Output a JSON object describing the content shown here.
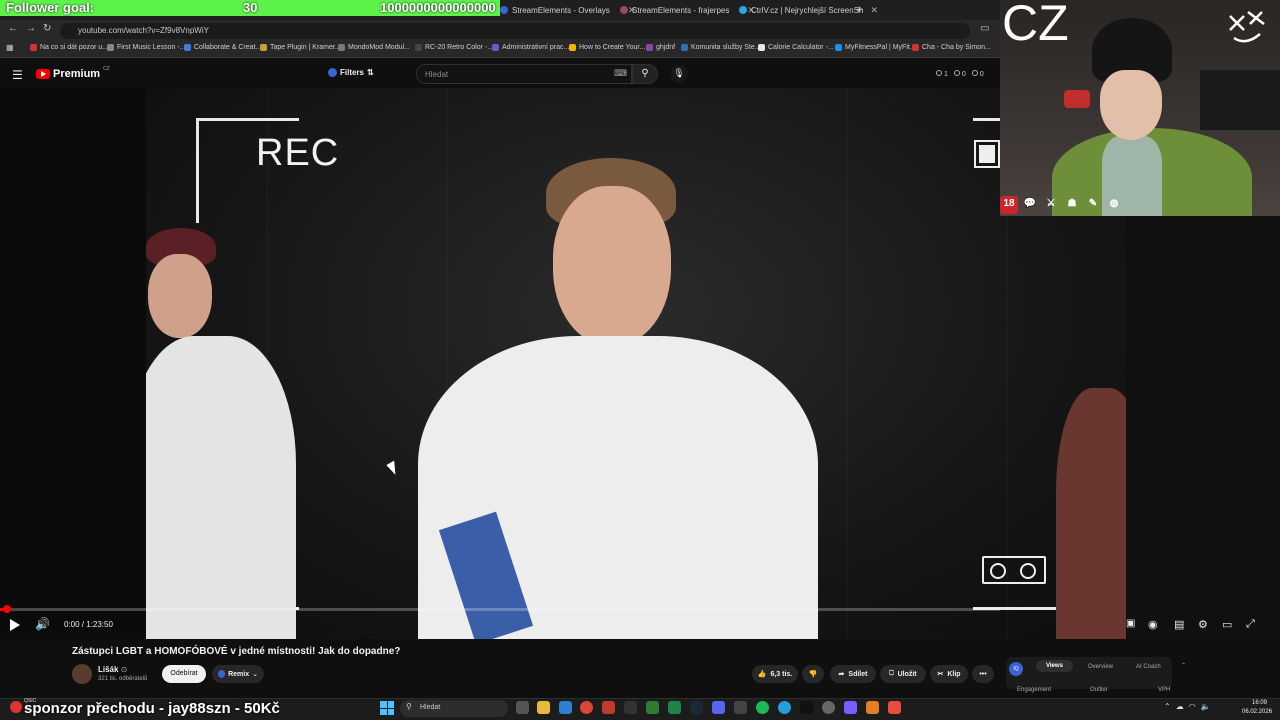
{
  "overlay": {
    "follower_goal_label": "Follower goal:",
    "follower_goal_current": "30",
    "follower_goal_target": "1000000000000000",
    "sponsor_text": "sponzor přechodu - jay88szn - 50Kč",
    "webcam_logo_text": "CZ",
    "webcam_badge_18": "18"
  },
  "browser": {
    "tabs": [
      {
        "label": "StreamElements - Overlays",
        "icon": "streamelements-icon"
      },
      {
        "label": "StreamElements - frajerpes",
        "icon": "streamelements-icon"
      },
      {
        "label": "CtrlV.cz | Nejrychlejší ScreenSh",
        "icon": "ctrlv-icon"
      }
    ],
    "new_tab_label": "+",
    "url": "youtube.com/watch?v=Zf9v8VnpWiY",
    "bookmarks": [
      {
        "label": "Na co si dát pozor u...",
        "color": "#d0342c"
      },
      {
        "label": "First Music Lesson -...",
        "color": "#888888"
      },
      {
        "label": "Collaborate & Creat...",
        "color": "#3d7be0"
      },
      {
        "label": "Tape Plugin | Kramer...",
        "color": "#c8a03a"
      },
      {
        "label": "MondoMod Modul...",
        "color": "#7a7a7a"
      },
      {
        "label": "RC-20 Retro Color -...",
        "color": "#444444"
      },
      {
        "label": "Administrativní prac...",
        "color": "#6a5acd"
      },
      {
        "label": "How to Create Your...",
        "color": "#f4b400"
      },
      {
        "label": "ghjdnf",
        "color": "#8e44ad"
      },
      {
        "label": "Komunita služby Ste...",
        "color": "#2c6fbb"
      },
      {
        "label": "Calorie Calculator -...",
        "color": "#e8e8e8"
      },
      {
        "label": "MyFitnessPal | MyFit...",
        "color": "#1a8fe3"
      },
      {
        "label": "Cha - Cha by Simon...",
        "color": "#d0342c"
      }
    ]
  },
  "youtube": {
    "brand": "Premium",
    "brand_region": "CZ",
    "filters_label": "Filters",
    "search_placeholder": "Hledat",
    "header_stats": [
      "1",
      "0",
      "0"
    ],
    "player": {
      "rec_text": "REC",
      "time": "0:00 / 1:23:50",
      "progress_fraction": 0.006
    },
    "video_title": "Zástupci LGBT a HOMOFÓBOVÉ v jedné místnosti! Jak do dopadne?",
    "channel": {
      "name": "Lišák",
      "verified_mark": "⊙",
      "subscribers": "321 tis. odběratelů",
      "unsubscribe_label": "Odebírat",
      "remix_label": "Remix"
    },
    "actions": {
      "likes": "6,3 tis.",
      "share": "Sdílet",
      "save": "Uložit",
      "clip": "Klip",
      "more": "•••"
    },
    "extension": {
      "logo_text": "IQ",
      "tabs": [
        "Views",
        "Overview",
        "AI Coach"
      ],
      "subtabs": [
        "Engagement",
        "Outlier",
        "VPH"
      ]
    }
  },
  "taskbar": {
    "media_label": "QSIC",
    "search_placeholder": "Hledat",
    "time": "16:09",
    "date": "06.02.2026"
  },
  "colors": {
    "accent_green": "#5df24a",
    "youtube_red": "#ff0000",
    "hoodie_green": "#6e8f3a"
  }
}
